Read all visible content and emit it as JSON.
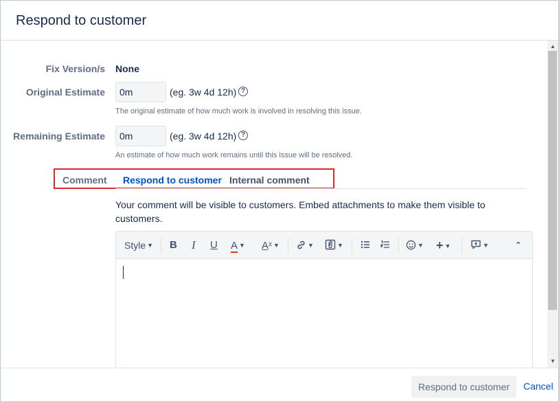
{
  "dialog": {
    "title": "Respond to customer"
  },
  "fields": {
    "fix_version": {
      "label": "Fix Version/s",
      "value": "None"
    },
    "original_estimate": {
      "label": "Original Estimate",
      "value": "0m",
      "hint": "(eg. 3w 4d 12h)",
      "description": "The original estimate of how much work is involved in resolving this issue."
    },
    "remaining_estimate": {
      "label": "Remaining Estimate",
      "value": "0m",
      "hint": "(eg. 3w 4d 12h)",
      "description": "An estimate of how much work remains until this issue will be resolved."
    }
  },
  "tabs": {
    "comment": "Comment",
    "respond": "Respond to customer",
    "internal": "Internal comment",
    "active": "respond"
  },
  "visibility_note": "Your comment will be visible to customers. Embed attachments to make them visible to customers.",
  "toolbar": {
    "style_label": "Style",
    "bold_label": "B",
    "italic_label": "I",
    "underline_label": "U",
    "color_label": "A",
    "text_color_accent": "#de350b"
  },
  "footer": {
    "primary_button": "Respond to customer",
    "cancel_link": "Cancel"
  },
  "colors": {
    "link": "#0052cc",
    "tab_border_highlight": "#d92b2b"
  }
}
